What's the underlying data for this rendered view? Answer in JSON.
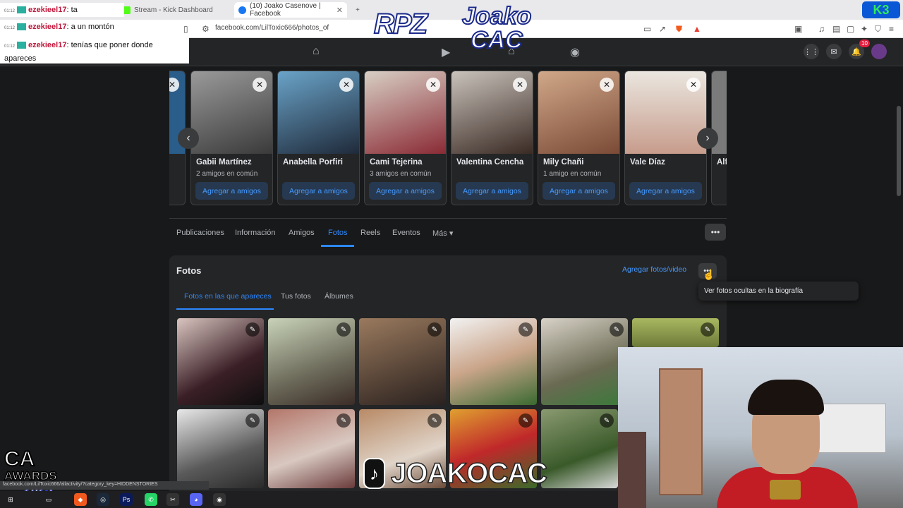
{
  "browser": {
    "tabs": [
      {
        "title": "Stream - Kick Dashboard",
        "fav_color": "#53fc18"
      },
      {
        "title": "(10) Joako Casenove | Facebook",
        "fav_color": "#1877f2"
      }
    ],
    "new_tab_label": "+",
    "url": "facebook.com/LilToxic666/photos_of"
  },
  "chat": [
    {
      "time": "01:12",
      "user": "ezekieel17",
      "text": ": ta"
    },
    {
      "time": "01:12",
      "user": "ezekieel17",
      "text": ": a un montón"
    },
    {
      "time": "01:12",
      "user": "ezekieel17",
      "text": ": tenías que poner donde apareces"
    }
  ],
  "overlay": {
    "logo_left": "RPZ",
    "logo_right_line1": "Joako",
    "logo_right_line2": "CAC",
    "k3": "K3",
    "tiktok_icon": "♪",
    "tiktok_name": "JOAKOCAC",
    "awards_line1": "CA",
    "awards_line2": "AWARDS",
    "awards_line3": "2025"
  },
  "fb_header": {
    "notif_count": "10"
  },
  "suggestions": [
    {
      "name": "",
      "mutual": "",
      "add": "",
      "color": "#2b5d8a"
    },
    {
      "name": "Gabii Martínez",
      "mutual": "2 amigos en común",
      "add": "Agregar a amigos",
      "color": "#6b6b6b"
    },
    {
      "name": "Anabella Porfiri",
      "mutual": "",
      "add": "Agregar a amigos",
      "color": "#3e6d8f"
    },
    {
      "name": "Cami Tejerina",
      "mutual": "3 amigos en común",
      "add": "Agregar a amigos",
      "color": "#8a2a35"
    },
    {
      "name": "Valentina Cencha",
      "mutual": "",
      "add": "Agregar a amigos",
      "color": "#5a4238"
    },
    {
      "name": "Mily Chañi",
      "mutual": "1 amigo en común",
      "add": "Agregar a amigos",
      "color": "#9c6a4e"
    },
    {
      "name": "Vale Díaz",
      "mutual": "",
      "add": "Agregar a amigos",
      "color": "#c7b9a8"
    },
    {
      "name": "Alfi",
      "mutual": "",
      "add": "",
      "color": "#7a7a7a"
    }
  ],
  "profile_tabs": [
    "Publicaciones",
    "Información",
    "Amigos",
    "Fotos",
    "Reels",
    "Eventos",
    "Más ▾"
  ],
  "photos": {
    "title": "Fotos",
    "add_label": "Agregar fotos/video",
    "tooltip": "Ver fotos ocultas en la biografía",
    "subtabs": [
      "Fotos en las que apareces",
      "Tus fotos",
      "Álbumes"
    ],
    "grid_colors": [
      "#4a2f36",
      "#8b8a7a",
      "#6f5644",
      "#b0a69a",
      "#7d7a6a",
      "#9aa060",
      "#8c8c8c",
      "#7a5a50",
      "#a08470",
      "#a97e3a",
      "#4e6a3c"
    ]
  },
  "status_url": "facebook.com/LilToxic666/allactivity/?category_key=HIDDENSTORIES"
}
